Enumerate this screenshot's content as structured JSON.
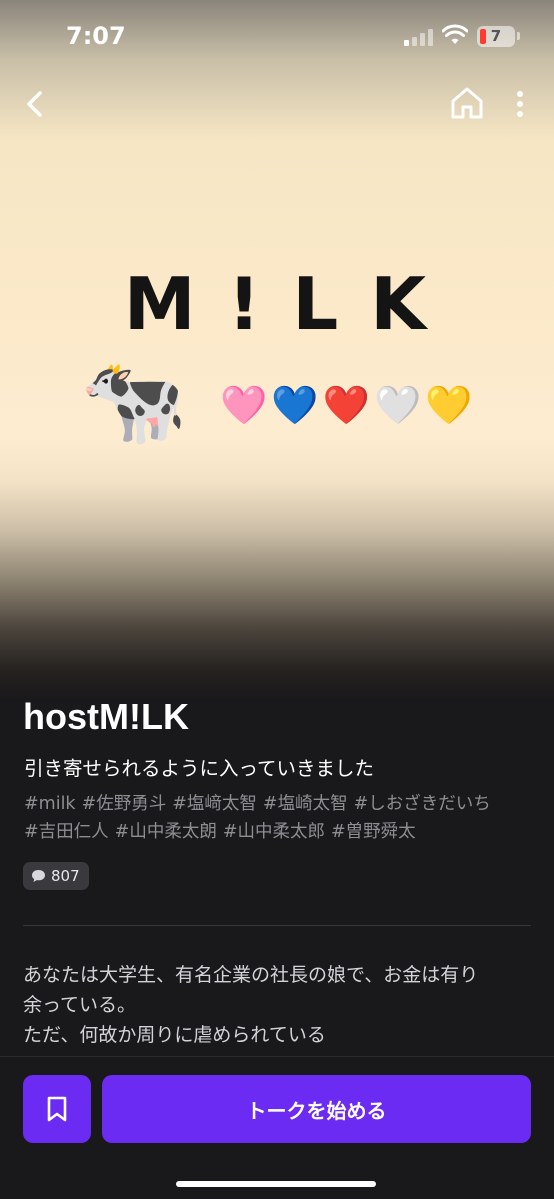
{
  "status_bar": {
    "time": "7:07",
    "battery_level": "7",
    "battery_color": "#ff3b30"
  },
  "nav": {
    "back_icon": "chevron-left-icon",
    "home_icon": "home-icon",
    "more_icon": "more-vertical-icon"
  },
  "cover": {
    "logo_text": "M!LK",
    "cow_emoji": "🐄",
    "hearts": "🩷💙❤️🤍💛"
  },
  "profile": {
    "title": "hostM!LK",
    "subtitle": "引き寄せられるように入っていきました",
    "tags": [
      "#milk",
      "#佐野勇斗",
      "#塩﨑太智",
      "#塩崎太智",
      "#しおざきだいち",
      "#吉田仁人",
      "#山中柔太朗",
      "#山中柔太郎",
      "#曽野舜太"
    ],
    "comment_icon": "speech-bubble-icon",
    "comment_count": "807"
  },
  "description": {
    "lines": [
      "あなたは大学生、有名企業の社長の娘で、お金は有り",
      "余っている。",
      "ただ、何故か周りに虐められている"
    ]
  },
  "bottom_bar": {
    "bookmark_icon": "bookmark-icon",
    "start_label": "トークを始める",
    "accent_color": "#6c2bf2"
  }
}
